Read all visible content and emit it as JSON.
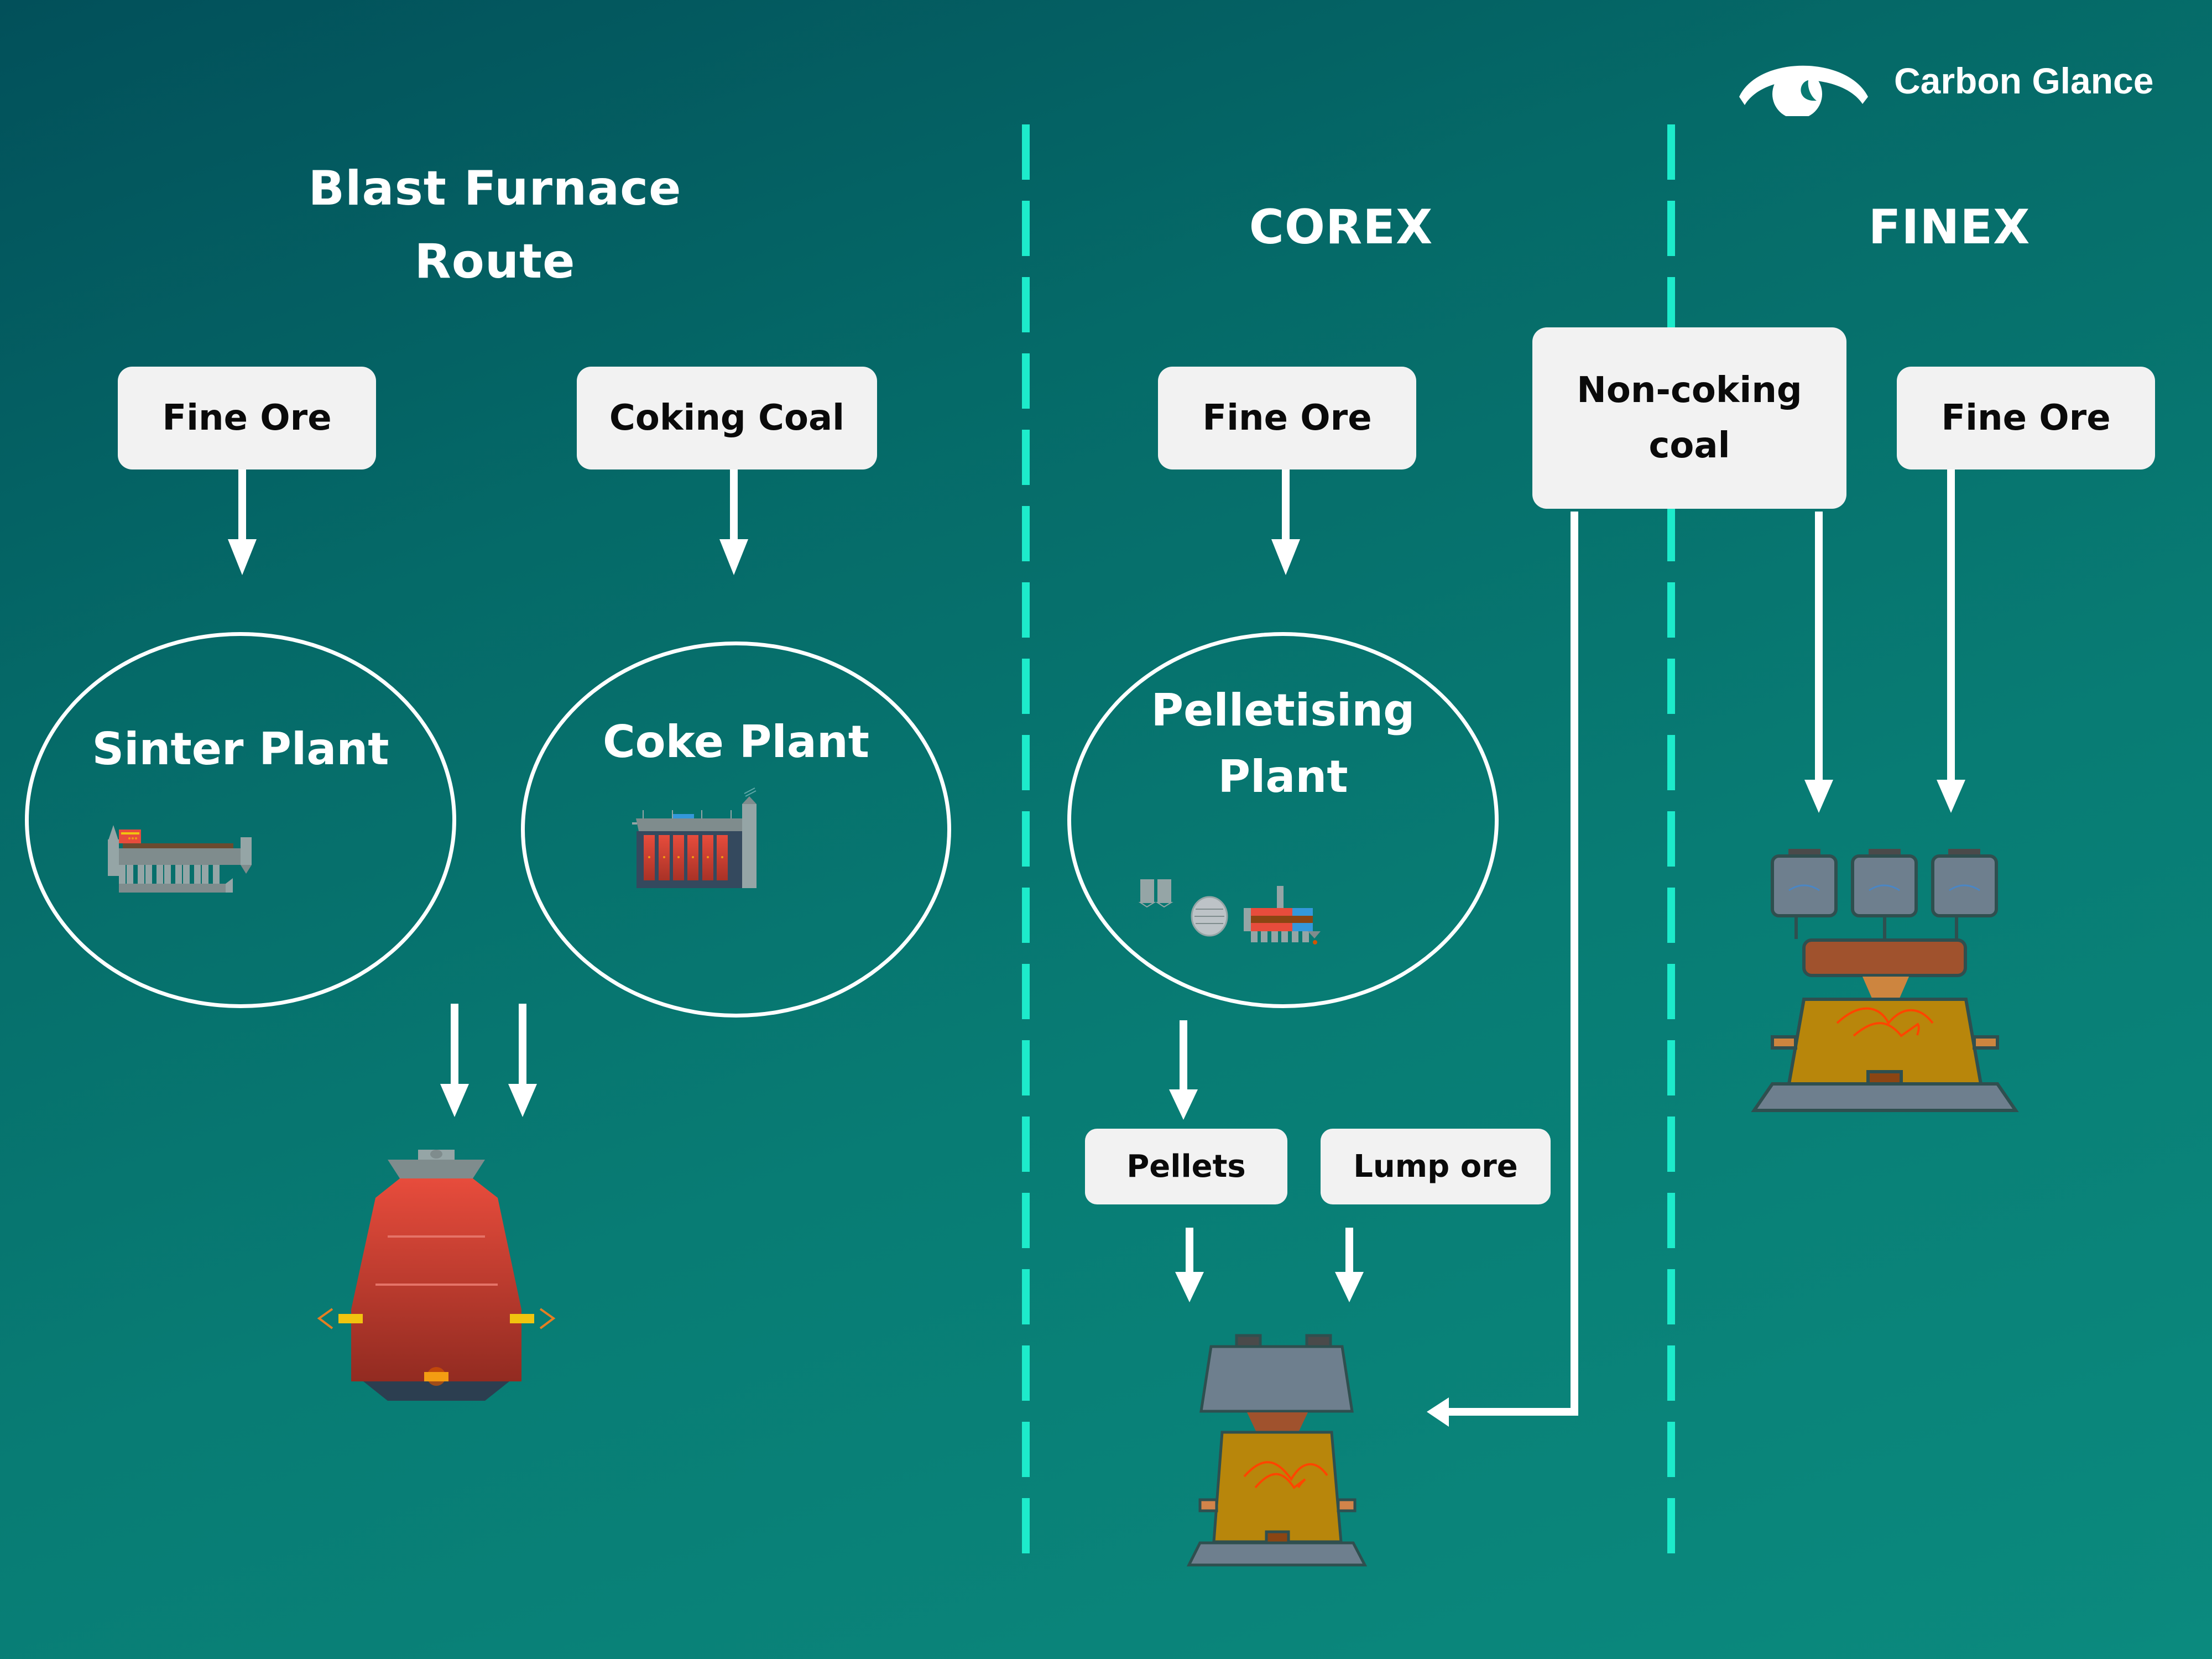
{
  "brand": {
    "name": "Carbon Glance",
    "logo_icon": "eye-icon"
  },
  "colors": {
    "background_start": "#02505A",
    "background_end": "#0B8A7E",
    "divider": "#1DEBCB",
    "box_fill": "#F2F2F2",
    "arrow": "#FFFFFF",
    "furnace_red": "#E34B3C",
    "reactor_gold": "#B8860B",
    "equipment_gray": "#6E7F8E"
  },
  "sections": {
    "blast_furnace": {
      "title_line1": "Blast Furnace",
      "title_line2": "Route",
      "inputs": [
        "Fine Ore",
        "Coking Coal"
      ],
      "plants": [
        "Sinter Plant",
        "Coke Plant"
      ],
      "output_unit": "blast-furnace-icon"
    },
    "corex": {
      "title": "COREX",
      "input": "Fine Ore",
      "plant_line1": "Pelletising",
      "plant_line2": "Plant",
      "products": [
        "Pellets",
        "Lump ore"
      ],
      "output_unit": "corex-reactor-icon"
    },
    "shared": {
      "non_coking_coal_line1": "Non-coking",
      "non_coking_coal_line2": "coal"
    },
    "finex": {
      "title": "FINEX",
      "input": "Fine Ore",
      "output_unit": "finex-reactor-icon"
    }
  }
}
